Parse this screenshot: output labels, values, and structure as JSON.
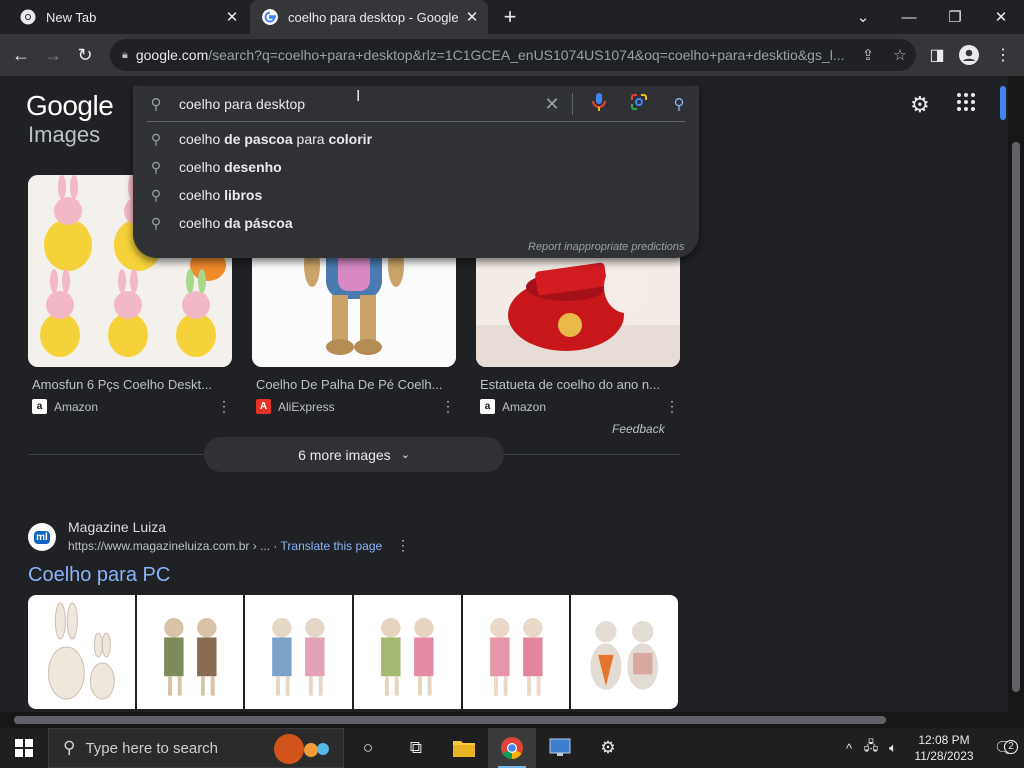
{
  "browser": {
    "tabs": [
      {
        "title": "New Tab",
        "active": false
      },
      {
        "title": "coelho para desktop - Google Se",
        "active": true
      }
    ],
    "url_host": "google.com",
    "url_rest": "/search?q=coelho+para+desktop&rlz=1C1GCEA_enUS1074US1074&oq=coelho+para+desktio&gs_l..."
  },
  "search": {
    "query": "coelho para desktop",
    "suggestions": [
      {
        "pre": "coelho ",
        "bold": "de pascoa ",
        "mid": "para ",
        "bold2": "colorir"
      },
      {
        "pre": "coelho ",
        "bold": "desenho",
        "mid": "",
        "bold2": ""
      },
      {
        "pre": "coelho ",
        "bold": "libros",
        "mid": "",
        "bold2": ""
      },
      {
        "pre": "coelho ",
        "bold": "da páscoa",
        "mid": "",
        "bold2": ""
      }
    ],
    "report_text": "Report inappropriate predictions"
  },
  "page": {
    "logo": "Google",
    "images_heading": "Images",
    "images": [
      {
        "caption": "Amosfun 6 Pçs Coelho Deskt...",
        "source": "Amazon",
        "source_icon": "a"
      },
      {
        "caption": "Coelho De Palha De Pé Coelh...",
        "source": "AliExpress",
        "source_icon": "A"
      },
      {
        "caption": "Estatueta de coelho do ano n...",
        "source": "Amazon",
        "source_icon": "a"
      }
    ],
    "feedback": "Feedback",
    "more_images": "6 more images",
    "result": {
      "site_name": "Magazine Luiza",
      "logo_text": "ml",
      "url": "https://www.magazineluiza.com.br › ...",
      "translate": "Translate this page",
      "title": "Coelho para PC"
    }
  },
  "taskbar": {
    "search_placeholder": "Type here to search",
    "time": "12:08 PM",
    "date": "11/28/2023",
    "notification_count": "2"
  },
  "colors": {
    "link": "#8ab4f8",
    "bg": "#202124",
    "google_blue": "#4285f4",
    "google_red": "#ea4335",
    "google_yellow": "#fbbc05",
    "google_green": "#34a853"
  }
}
